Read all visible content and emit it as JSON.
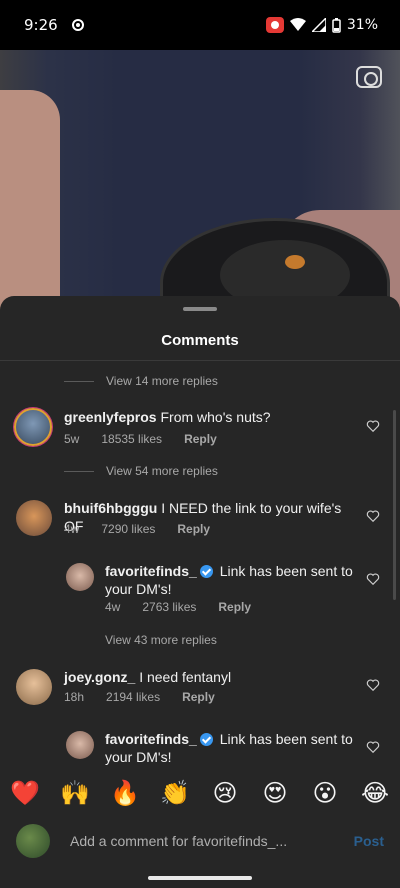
{
  "status": {
    "time": "9:26",
    "battery": "31%"
  },
  "sheet": {
    "title": "Comments"
  },
  "threads": [
    {
      "view_more": "View 14 more replies"
    },
    {
      "username": "greenlyfepros",
      "text": "From who's nuts?",
      "age": "5w",
      "likes": "18535 likes",
      "reply": "Reply",
      "view_more": "View 54 more replies"
    },
    {
      "username": "bhuif6hbgggu",
      "text": "I NEED the link to your wife's OF",
      "age": "4w",
      "likes": "7290 likes",
      "reply": "Reply"
    },
    {
      "username": "favoritefinds_",
      "text": "Link has been sent to your DM's!",
      "age": "4w",
      "likes": "2763 likes",
      "reply": "Reply",
      "view_more": "View 43 more replies"
    },
    {
      "username": "joey.gonz_",
      "text": "I need fentanyl",
      "age": "18h",
      "likes": "2194 likes",
      "reply": "Reply"
    },
    {
      "username": "favoritefinds_",
      "text": "Link has been sent to your DM's!"
    }
  ],
  "emojis": [
    "❤️",
    "🙌",
    "🔥",
    "👏",
    "😢",
    "😍",
    "😮",
    "😂"
  ],
  "composer": {
    "placeholder": "Add a comment for favoritefinds_...",
    "post": "Post"
  },
  "icons": {
    "camera": "camera-icon",
    "heart": "heart-icon"
  },
  "colors": {
    "sheet_bg": "#262626",
    "verified": "#3897f0",
    "post": "#2a5f8f"
  }
}
